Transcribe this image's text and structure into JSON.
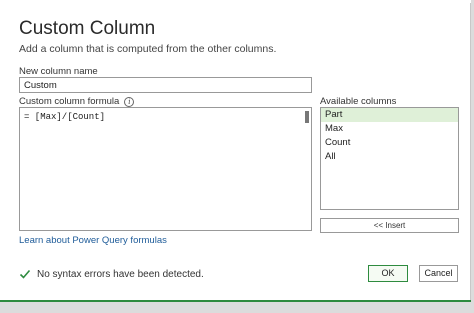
{
  "dialog": {
    "title": "Custom Column",
    "subtitle": "Add a column that is computed from the other columns."
  },
  "new_column": {
    "label": "New column name",
    "value": "Custom"
  },
  "formula": {
    "label": "Custom column formula",
    "value": "= [Max]/[Count]"
  },
  "available_columns": {
    "label": "Available columns",
    "items": [
      "Part",
      "Max",
      "Count",
      "All"
    ],
    "selected": "Part",
    "insert_label": "<< Insert"
  },
  "links": {
    "learn": "Learn about Power Query formulas"
  },
  "status": {
    "text": "No syntax errors have been detected."
  },
  "buttons": {
    "ok": "OK",
    "cancel": "Cancel"
  },
  "colors": {
    "accent": "#2e8b3f",
    "link": "#1f5c99",
    "selected_bg": "#dff0d8"
  },
  "icons": {
    "info": "info-icon",
    "status": "check-icon"
  }
}
